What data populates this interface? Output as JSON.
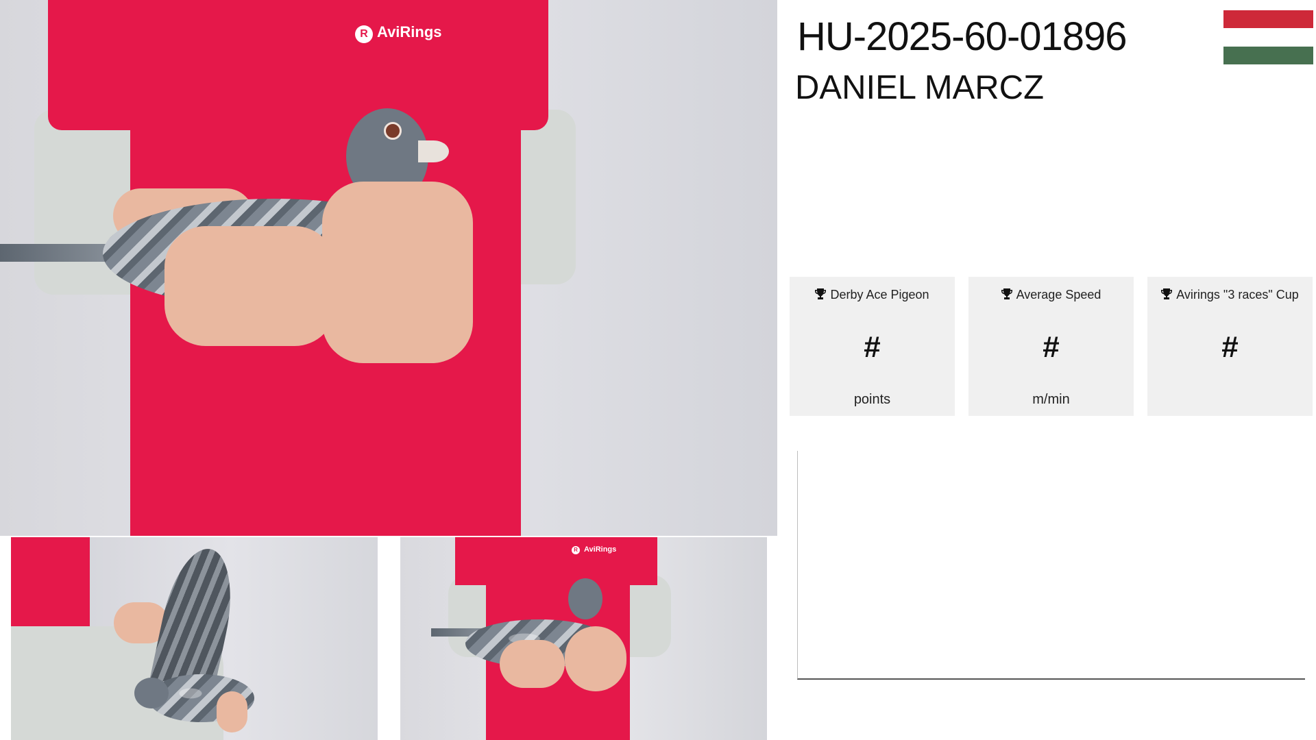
{
  "header": {
    "ring_id": "HU-2025-60-01896",
    "owner": "DANIEL MARCZ",
    "flag_colors": [
      "#ce2939",
      "#ffffff",
      "#477050"
    ]
  },
  "photos": {
    "main_logo": "AviRings",
    "small_logo": "AviRings"
  },
  "stats": [
    {
      "title": "Derby Ace Pigeon",
      "value": "#",
      "unit": "points",
      "icon": "trophy-icon"
    },
    {
      "title": "Average Speed",
      "value": "#",
      "unit": "m/min",
      "icon": "trophy-icon"
    },
    {
      "title": "Avirings \"3 races\" Cup",
      "value": "#",
      "unit": "",
      "icon": "trophy-icon"
    }
  ],
  "colors": {
    "shirt": "#e5184a",
    "card_bg": "#f0f0f0"
  }
}
